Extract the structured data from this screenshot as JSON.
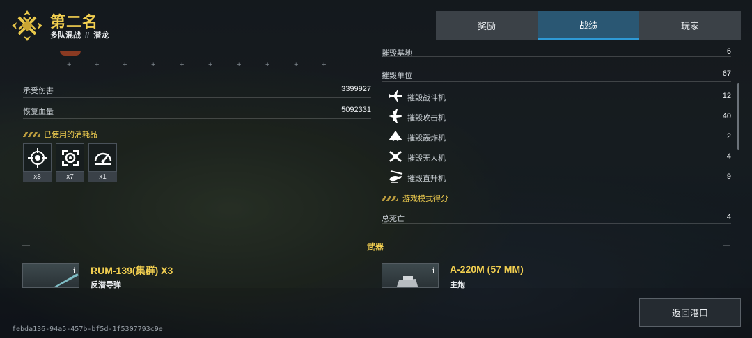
{
  "header": {
    "rank_title": "第二名",
    "mode": "多队混战",
    "separator": "//",
    "map": "潜龙"
  },
  "tabs": [
    {
      "label": "奖励",
      "active": false
    },
    {
      "label": "战绩",
      "active": true
    },
    {
      "label": "玩家",
      "active": false
    }
  ],
  "left": {
    "damage_taken": {
      "label": "承受伤害",
      "value": "3399927"
    },
    "hp_restored": {
      "label": "恢复血量",
      "value": "5092331"
    },
    "consumables_title": "已使用的消耗品",
    "consumables": [
      {
        "icon": "target-crosshair-icon",
        "count": "x8"
      },
      {
        "icon": "repair-kit-icon",
        "count": "x7"
      },
      {
        "icon": "speed-gauge-icon",
        "count": "x1"
      }
    ]
  },
  "right": {
    "destroyed_bases": {
      "label": "摧毁基地",
      "value": "6"
    },
    "destroyed_units": {
      "label": "摧毁单位",
      "value": "67"
    },
    "unit_breakdown": [
      {
        "icon": "fighter-jet-icon",
        "label": "摧毁战斗机",
        "value": "12"
      },
      {
        "icon": "attack-jet-icon",
        "label": "摧毁攻击机",
        "value": "40"
      },
      {
        "icon": "bomber-icon",
        "label": "摧毁轰炸机",
        "value": "2"
      },
      {
        "icon": "drone-icon",
        "label": "摧毁无人机",
        "value": "4"
      },
      {
        "icon": "helicopter-icon",
        "label": "摧毁直升机",
        "value": "9"
      }
    ],
    "game_mode_score_title": "游戏模式得分",
    "total_deaths": {
      "label": "总死亡",
      "value": "4"
    }
  },
  "weapons": {
    "title": "武器",
    "items": [
      {
        "name": "RUM-139(集群) X3",
        "type": "反潜导弹"
      },
      {
        "name": "A-220M (57 MM)",
        "type": "主炮"
      }
    ],
    "info_glyph": "i"
  },
  "footer": {
    "return_label": "返回港口",
    "session_id": "febda136-94a5-457b-bf5d-1f5307793c9e"
  },
  "colors": {
    "accent_gold": "#f2cf50",
    "tab_active": "#2a5773",
    "tab_active_underline": "#2e9ad6"
  }
}
